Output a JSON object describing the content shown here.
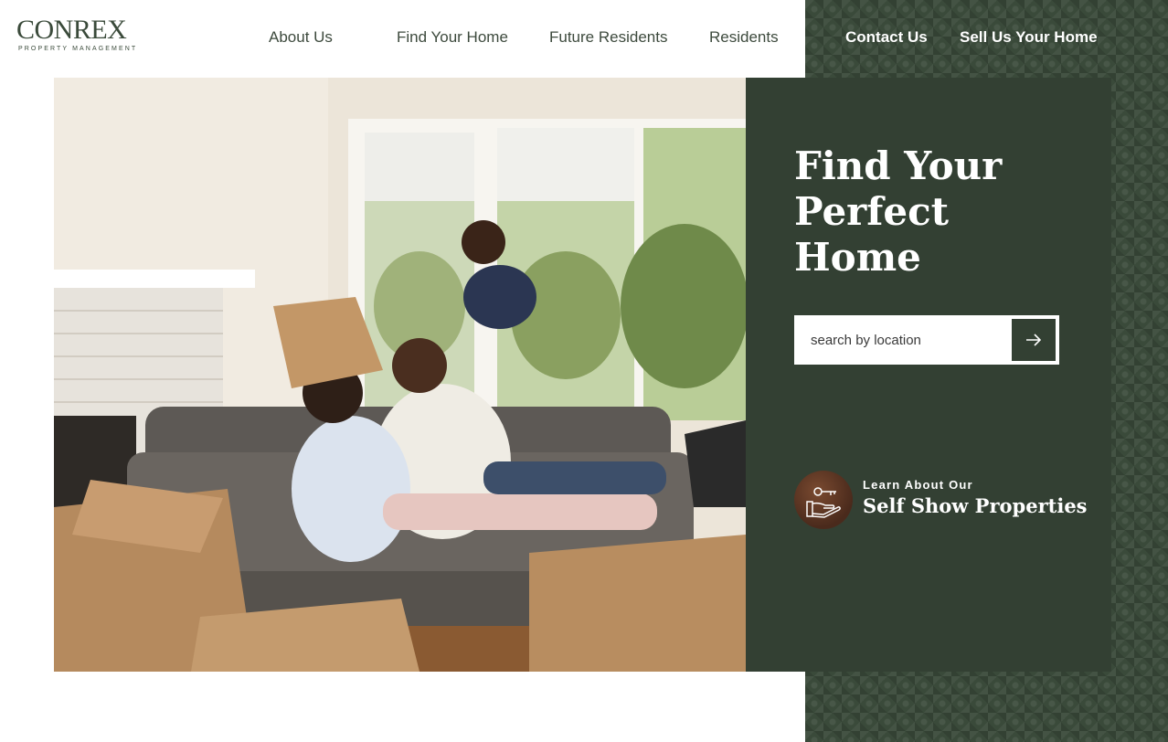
{
  "brand": {
    "name": "CONREX",
    "tagline": "PROPERTY MANAGEMENT"
  },
  "nav": {
    "items": [
      {
        "label": "About Us"
      },
      {
        "label": "Find Your Home"
      },
      {
        "label": "Future Residents"
      },
      {
        "label": "Residents"
      },
      {
        "label": "Contact Us"
      },
      {
        "label": "Sell Us Your Home"
      }
    ]
  },
  "hero": {
    "title_line1": "Find Your",
    "title_line2": "Perfect Home",
    "search": {
      "placeholder": "search by location",
      "button_icon": "arrow-right-icon"
    },
    "self_show": {
      "kicker": "Learn About Our",
      "title": "Self Show Properties",
      "icon": "hand-key-icon"
    },
    "photo": "family-moving-in-photo"
  },
  "colors": {
    "brand_green": "#334033",
    "pattern_green": "#3a4a3a",
    "text_dark": "#3d4a3d",
    "white": "#ffffff"
  }
}
